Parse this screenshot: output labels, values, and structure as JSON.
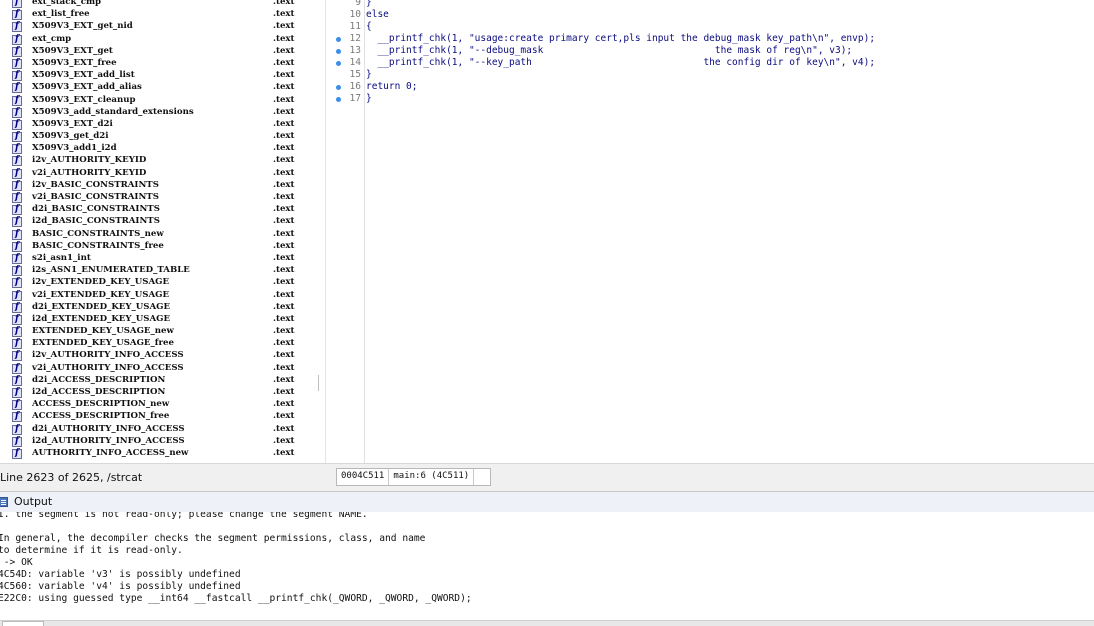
{
  "functions": {
    "segment_label": ".text",
    "items": [
      "ext_stack_cmp",
      "ext_list_free",
      "X509V3_EXT_get_nid",
      "ext_cmp",
      "X509V3_EXT_get",
      "X509V3_EXT_free",
      "X509V3_EXT_add_list",
      "X509V3_EXT_add_alias",
      "X509V3_EXT_cleanup",
      "X509V3_add_standard_extensions",
      "X509V3_EXT_d2i",
      "X509V3_get_d2i",
      "X509V3_add1_i2d",
      "i2v_AUTHORITY_KEYID",
      "v2i_AUTHORITY_KEYID",
      "i2v_BASIC_CONSTRAINTS",
      "v2i_BASIC_CONSTRAINTS",
      "d2i_BASIC_CONSTRAINTS",
      "i2d_BASIC_CONSTRAINTS",
      "BASIC_CONSTRAINTS_new",
      "BASIC_CONSTRAINTS_free",
      "s2i_asn1_int",
      "i2s_ASN1_ENUMERATED_TABLE",
      "i2v_EXTENDED_KEY_USAGE",
      "v2i_EXTENDED_KEY_USAGE",
      "d2i_EXTENDED_KEY_USAGE",
      "i2d_EXTENDED_KEY_USAGE",
      "EXTENDED_KEY_USAGE_new",
      "EXTENDED_KEY_USAGE_free",
      "i2v_AUTHORITY_INFO_ACCESS",
      "v2i_AUTHORITY_INFO_ACCESS",
      "d2i_ACCESS_DESCRIPTION",
      "i2d_ACCESS_DESCRIPTION",
      "ACCESS_DESCRIPTION_new",
      "ACCESS_DESCRIPTION_free",
      "d2i_AUTHORITY_INFO_ACCESS",
      "i2d_AUTHORITY_INFO_ACCESS",
      "AUTHORITY_INFO_ACCESS_new"
    ],
    "status": "Line 2623 of 2625, /strcat"
  },
  "pseudocode": {
    "lines": [
      {
        "num": "9",
        "text": "}",
        "dot": false
      },
      {
        "num": "10",
        "text": "else",
        "dot": false
      },
      {
        "num": "11",
        "text": "{",
        "dot": false
      },
      {
        "num": "12",
        "text": "  __printf_chk(1, \"usage:create primary cert,pls input the debug_mask key_path\\n\", envp);",
        "dot": true
      },
      {
        "num": "13",
        "text": "  __printf_chk(1, \"--debug_mask                              the mask of reg\\n\", v3);",
        "dot": true
      },
      {
        "num": "14",
        "text": "  __printf_chk(1, \"--key_path                              the config dir of key\\n\", v4);",
        "dot": true
      },
      {
        "num": "15",
        "text": "}",
        "dot": false
      },
      {
        "num": "16",
        "text": "return 0;",
        "dot": true
      },
      {
        "num": "17",
        "text": "}",
        "dot": true
      }
    ],
    "status": {
      "address": "0004C511",
      "location": "main:6 (4C511)"
    }
  },
  "output": {
    "title": "Output",
    "lines": [
      "I. the segment is not read-only; please change the segment NAME.",
      "",
      "In general, the decompiler checks the segment permissions, class, and name",
      "to determine if it is read-only.",
      " -> OK",
      "4C54D: variable 'v3' is possibly undefined",
      "4C560: variable 'v4' is possibly undefined",
      "E22C0: using guessed type __int64 __fastcall __printf_chk(_QWORD, _QWORD, _QWORD);"
    ]
  },
  "colors": {
    "line_dot": "#3c8ee8",
    "code_text": "#0b0b80"
  }
}
